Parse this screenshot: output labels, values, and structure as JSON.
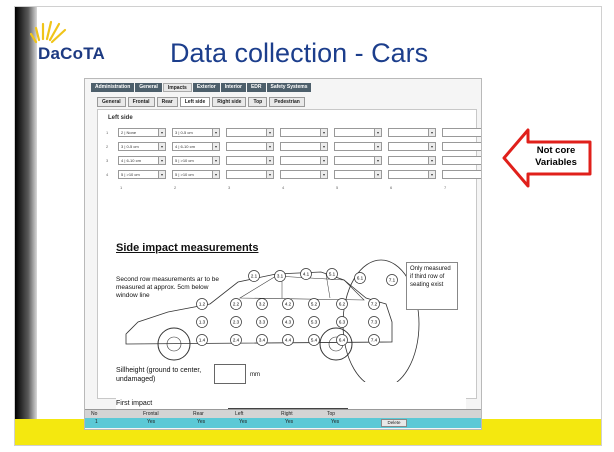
{
  "slide": {
    "logo_text": "DaCoTA",
    "title": "Data collection - Cars",
    "arrow_label": "Not core Variables",
    "colors": {
      "title": "#1c3e8c",
      "accent_yellow": "#f4e80f",
      "arrow_red": "#e0201b"
    }
  },
  "form": {
    "main_tabs": [
      "Administration",
      "General",
      "Impacts",
      "Exterior",
      "Interior",
      "EDR",
      "Safety Systems"
    ],
    "active_main_tab": "Impacts",
    "sub_tabs": [
      "General",
      "Frontal",
      "Rear",
      "Left side",
      "Right side",
      "Top",
      "Pedestrian"
    ],
    "active_sub_tab": "Left side",
    "section_label": "Left side",
    "row_numbers": [
      "1",
      "2",
      "3",
      "4"
    ],
    "rows": [
      [
        "2 | None",
        "3 | 0-5 cm",
        "",
        "",
        "",
        "",
        ""
      ],
      [
        "3 | 0-5 cm",
        "4 | 6-10 cm",
        "",
        "",
        "",
        "",
        ""
      ],
      [
        "4 | 6-10 cm",
        "5 | >10 cm",
        "",
        "",
        "",
        "",
        ""
      ],
      [
        "5 | >10 cm",
        "5 | >10 cm",
        "",
        "",
        "",
        "",
        ""
      ]
    ],
    "column_numbers": [
      "1",
      "2",
      "3",
      "4",
      "5",
      "6",
      "7"
    ],
    "diagram": {
      "title": "Side impact measurements",
      "note": "Second row measurements  ar to be measured at approx. 5cm below window line",
      "callout": "Only measured if third row of seating exist",
      "sill_label": "Sillheight (ground to center, undamaged)",
      "mm_label": "mm",
      "first_impact_label": "First impact",
      "points": [
        "2.1",
        "3.1",
        "4.1",
        "5.1",
        "6.1",
        "7.1",
        "1.2",
        "2.2",
        "3.2",
        "4.2",
        "5.2",
        "6.2",
        "7.2",
        "1.3",
        "2.3",
        "3.3",
        "4.3",
        "5.3",
        "6.3",
        "7.3",
        "1.4",
        "2.4",
        "3.4",
        "4.4",
        "5.4",
        "6.4",
        "7.4"
      ]
    },
    "grid": {
      "headers": [
        "No",
        "Frontal",
        "Rear",
        "Left",
        "Right",
        "Top"
      ],
      "row": [
        "1",
        "Yes",
        "Yes",
        "Yes",
        "Yes",
        "Yes"
      ],
      "delete_label": "Delete"
    }
  }
}
